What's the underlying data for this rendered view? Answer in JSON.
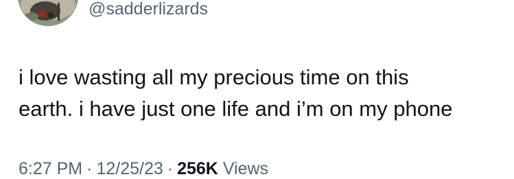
{
  "author": {
    "handle": "@sadderlizards",
    "avatar_icon": "profile-avatar"
  },
  "tweet": {
    "lines": [
      "i love wasting all my precious time on this",
      "earth. i have just one life and i’m on my phone"
    ]
  },
  "meta": {
    "time": "6:27 PM",
    "date": "12/25/23",
    "separator": "·",
    "views_count": "256K",
    "views_label": "Views"
  },
  "colors": {
    "text_primary": "#0f1419",
    "text_secondary": "#536471",
    "background": "#ffffff"
  }
}
